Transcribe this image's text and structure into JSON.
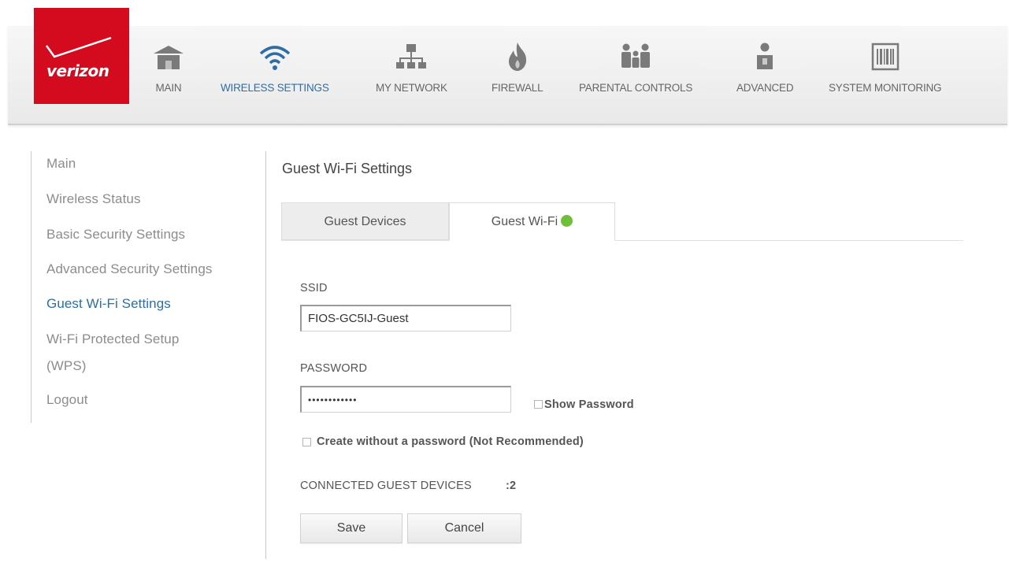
{
  "brand": {
    "logo_text": "verizon",
    "logo_color": "#d40b1f"
  },
  "topnav": {
    "active_color": "#2d6ea6",
    "items": [
      {
        "label": "MAIN",
        "icon": "home-icon"
      },
      {
        "label": "WIRELESS SETTINGS",
        "icon": "wifi-icon"
      },
      {
        "label": "MY NETWORK",
        "icon": "network-icon"
      },
      {
        "label": "FIREWALL",
        "icon": "flame-icon"
      },
      {
        "label": "PARENTAL CONTROLS",
        "icon": "family-icon"
      },
      {
        "label": "ADVANCED",
        "icon": "person-icon"
      },
      {
        "label": "SYSTEM MONITORING",
        "icon": "barcode-icon"
      }
    ]
  },
  "sidebar": {
    "items": [
      {
        "label": "Main"
      },
      {
        "label": "Wireless Status"
      },
      {
        "label": "Basic Security Settings"
      },
      {
        "label": "Advanced Security Settings"
      },
      {
        "label": "Guest Wi-Fi Settings"
      },
      {
        "label": "Wi-Fi Protected Setup"
      },
      {
        "label": "(WPS)"
      },
      {
        "label": "Logout"
      }
    ]
  },
  "main": {
    "title": "Guest Wi-Fi Settings",
    "tabs": [
      {
        "label": "Guest Devices"
      },
      {
        "label": "Guest Wi-Fi",
        "status_color": "#6fbf3b"
      }
    ],
    "ssid": {
      "label": "SSID",
      "value": "FIOS-GC5IJ-Guest"
    },
    "password": {
      "label": "PASSWORD",
      "value": "••••••••••••",
      "show_password_label": "Show Password"
    },
    "no_password_label": "Create without a password (Not Recommended)",
    "connected": {
      "label": "CONNECTED GUEST DEVICES",
      "value": ":2"
    },
    "buttons": {
      "save": "Save",
      "cancel": "Cancel"
    }
  }
}
